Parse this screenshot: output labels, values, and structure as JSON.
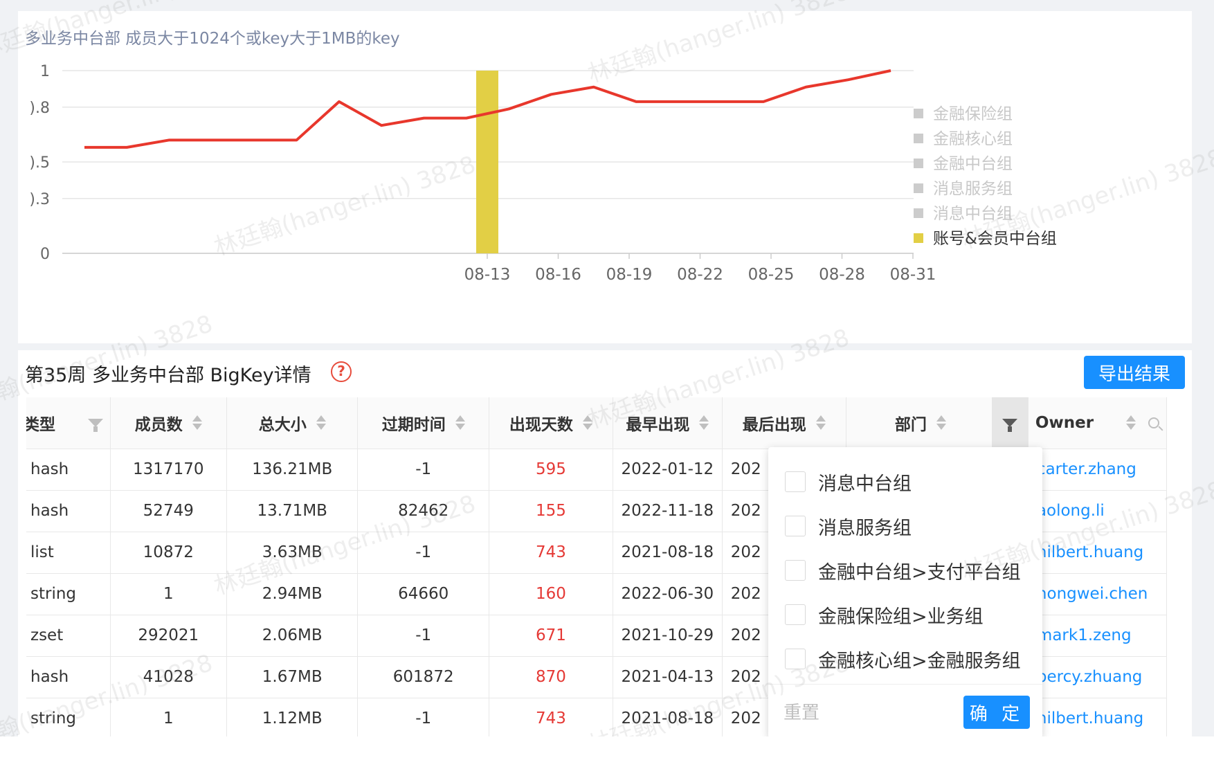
{
  "chart_card": {
    "title": "多业务中台部 成员大于1024个或key大于1MB的key"
  },
  "chart_data": {
    "type": "line",
    "title": "多业务中台部 成员大于1024个或key大于1MB的key",
    "y_tick_labels": [
      "1",
      ").8",
      ").5",
      ").3",
      "0"
    ],
    "y_tick_values": [
      1,
      0.8,
      0.5,
      0.3,
      0
    ],
    "ylim": [
      0,
      1
    ],
    "x_tick_labels": [
      "08-13",
      "08-16",
      "08-19",
      "08-22",
      "08-25",
      "08-28",
      "08-31"
    ],
    "grid": "horizontal",
    "legend_position": "right",
    "series": [
      {
        "name": "账号&会员中台组",
        "type": "line",
        "color": "#e8372c",
        "values": [
          0.58,
          0.58,
          0.62,
          0.62,
          0.62,
          0.62,
          0.83,
          0.7,
          0.74,
          0.74,
          0.79,
          0.87,
          0.91,
          0.83,
          0.83,
          0.83,
          0.83,
          0.91,
          0.95,
          1.0
        ]
      },
      {
        "name": "账号&会员中台组",
        "type": "bar",
        "color": "#e2cf45",
        "x_index": 9,
        "value": 1
      }
    ],
    "legend": [
      {
        "label": "金融保险组",
        "active": false
      },
      {
        "label": "金融核心组",
        "active": false
      },
      {
        "label": "金融中台组",
        "active": false
      },
      {
        "label": "消息服务组",
        "active": false
      },
      {
        "label": "消息中台组",
        "active": false
      },
      {
        "label": "账号&会员中台组",
        "active": true
      }
    ],
    "colors": {
      "line": "#e8372c",
      "bar": "#e2cf45",
      "legend_inactive": "#cccccc",
      "legend_active": "#e2cf45"
    }
  },
  "table_card": {
    "title": "第35周 多业务中台部 BigKey详情",
    "help_icon": "?",
    "export_label": "导出结果",
    "columns": {
      "type": "类型",
      "members": "成员数",
      "size": "总大小",
      "expire": "过期时间",
      "days": "出现天数",
      "first": "最早出现",
      "last": "最后出现",
      "dept": "部门",
      "owner": "Owner"
    },
    "rows": [
      {
        "type": "hash",
        "members": "1317170",
        "size": "136.21MB",
        "expire": "-1",
        "days": "595",
        "first": "2022-01-12",
        "last": "202",
        "owner": "carter.zhang"
      },
      {
        "type": "hash",
        "members": "52749",
        "size": "13.71MB",
        "expire": "82462",
        "days": "155",
        "first": "2022-11-18",
        "last": "202",
        "owner": "aolong.li"
      },
      {
        "type": "list",
        "members": "10872",
        "size": "3.63MB",
        "expire": "-1",
        "days": "743",
        "first": "2021-08-18",
        "last": "202",
        "owner": "hilbert.huang"
      },
      {
        "type": "string",
        "members": "1",
        "size": "2.94MB",
        "expire": "64660",
        "days": "160",
        "first": "2022-06-30",
        "last": "202",
        "owner": "hongwei.chen"
      },
      {
        "type": "zset",
        "members": "292021",
        "size": "2.06MB",
        "expire": "-1",
        "days": "671",
        "first": "2021-10-29",
        "last": "202",
        "owner": "mark1.zeng"
      },
      {
        "type": "hash",
        "members": "41028",
        "size": "1.67MB",
        "expire": "601872",
        "days": "870",
        "first": "2021-04-13",
        "last": "202",
        "owner": "percy.zhuang"
      },
      {
        "type": "string",
        "members": "1",
        "size": "1.12MB",
        "expire": "-1",
        "days": "743",
        "first": "2021-08-18",
        "last": "202",
        "owner": "hilbert.huang"
      }
    ]
  },
  "dept_filter": {
    "options": [
      "消息中台组",
      "消息服务组",
      "金融中台组>支付平台组",
      "金融保险组>业务组",
      "金融核心组>金融服务组"
    ],
    "reset_label": "重置",
    "confirm_label": "确 定"
  },
  "watermark": {
    "text": "林廷翰(hanger.lin) 3828"
  },
  "icons": {
    "filter": "funnel-icon",
    "sort": "sort-arrows-icon",
    "search": "search-icon",
    "help": "question-circle-icon"
  }
}
